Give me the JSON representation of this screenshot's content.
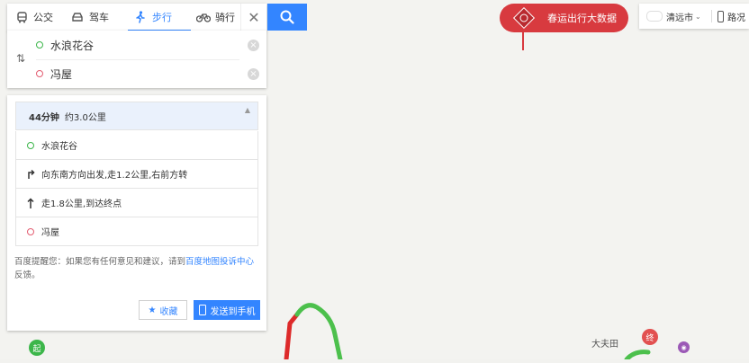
{
  "tabs": [
    {
      "label": "公交",
      "icon": "bus-icon"
    },
    {
      "label": "驾车",
      "icon": "car-icon"
    },
    {
      "label": "步行",
      "icon": "walk-icon",
      "active": true
    },
    {
      "label": "骑行",
      "icon": "bike-icon"
    }
  ],
  "route": {
    "start": "水浪花谷",
    "end": "冯屋"
  },
  "result": {
    "duration": "44分钟",
    "distance": "约3.0公里",
    "steps": [
      {
        "text": "水浪花谷",
        "icon": "start-dot-icon"
      },
      {
        "text": "向东南方向出发,走1.2公里,右前方转",
        "icon": "turn-right-icon"
      },
      {
        "text": "走1.8公里,到达终点",
        "icon": "straight-arrow-icon"
      },
      {
        "text": "冯屋",
        "icon": "end-dot-icon"
      }
    ],
    "note_prefix": "百度提醒您：如果您有任何意见和建议，请到",
    "note_link": "百度地图投诉中心",
    "note_suffix": "反馈。",
    "fav_label": "收藏",
    "send_label": "发送到手机"
  },
  "banner": {
    "label": "春运出行大数据"
  },
  "toolbar": {
    "city": "清远市",
    "traffic": "路况"
  },
  "map": {
    "place_label": "大夫田",
    "start_pin": "起",
    "end_pin": "终"
  },
  "colors": {
    "accent": "#3385ff",
    "route_green": "#4cc04c",
    "route_red": "#dd2a2a",
    "banner_red": "#d83a3f"
  }
}
